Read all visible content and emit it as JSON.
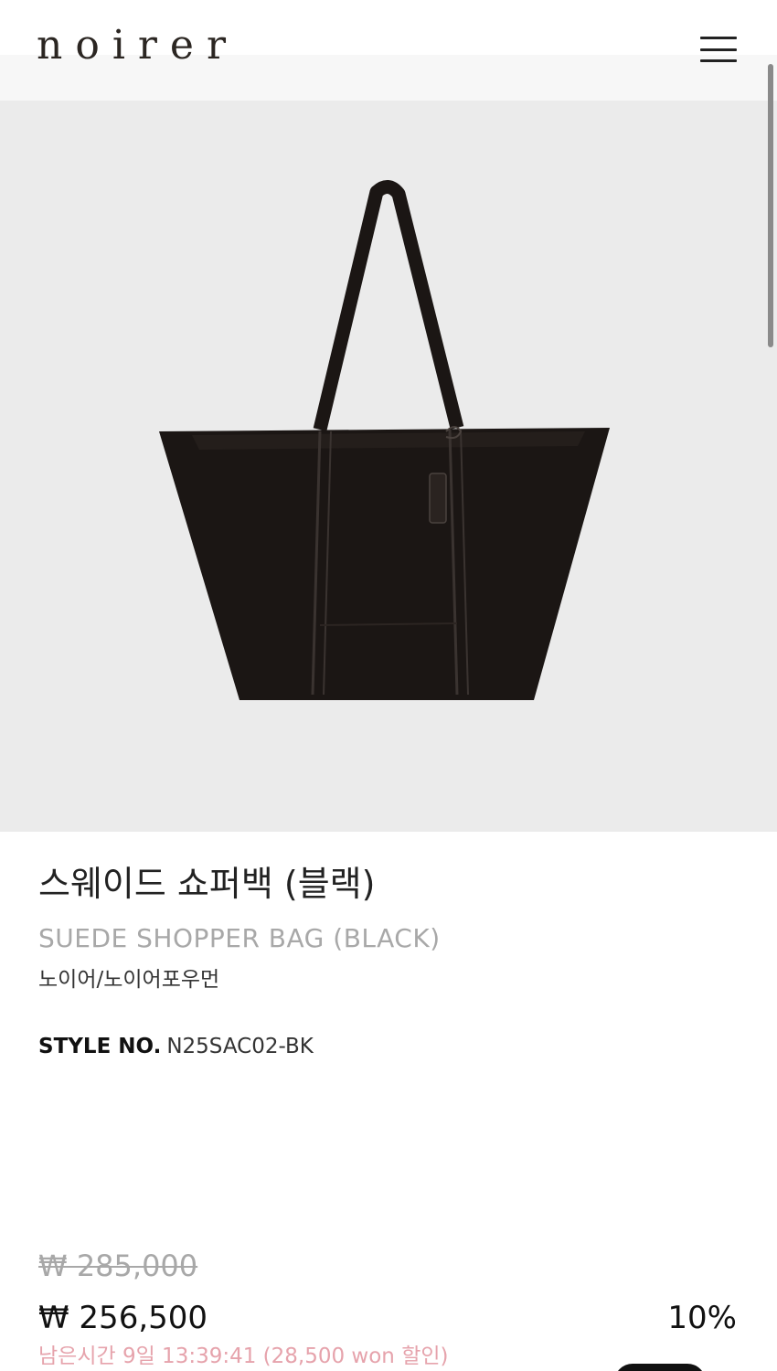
{
  "header": {
    "logo": "noirer",
    "menu_icon": "hamburger-menu-icon"
  },
  "product": {
    "image_alt": "black suede shopper tote bag",
    "name_ko": "스웨이드 쇼퍼백 (블랙)",
    "name_en": "SUEDE SHOPPER BAG (BLACK)",
    "brand": "노이어/노이어포우먼",
    "style_label": "STYLE NO.",
    "style_no": "N25SAC02-BK"
  },
  "pricing": {
    "original_price": "₩ 285,000",
    "sale_price": "₩ 256,500",
    "discount": "10%",
    "countdown": "남은시간 9일 13:39:41 (28,500 won 할인)"
  },
  "colors": {
    "image_background": "#ebebeb",
    "bag": "#1b1614",
    "countdown_text": "#e6a3ac",
    "muted_text": "#a8a8a8"
  }
}
